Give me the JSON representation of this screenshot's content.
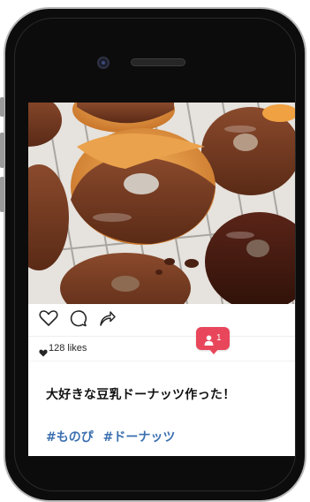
{
  "post": {
    "likes_text": "128 likes",
    "caption": "大好きな豆乳ドーナッツ作った！",
    "hashtags": [
      "#ものぴ",
      "#ドーナッツ"
    ]
  },
  "notification": {
    "count": "1",
    "icon": "person-icon",
    "color": "#e8465a"
  },
  "icons": {
    "like": "heart-outline-icon",
    "comment": "speech-bubble-icon",
    "share": "share-arrow-icon",
    "likes_heart": "heart-filled-icon"
  },
  "colors": {
    "hashtag": "#3b6fb0",
    "phone_body": "#0c0c0c"
  }
}
